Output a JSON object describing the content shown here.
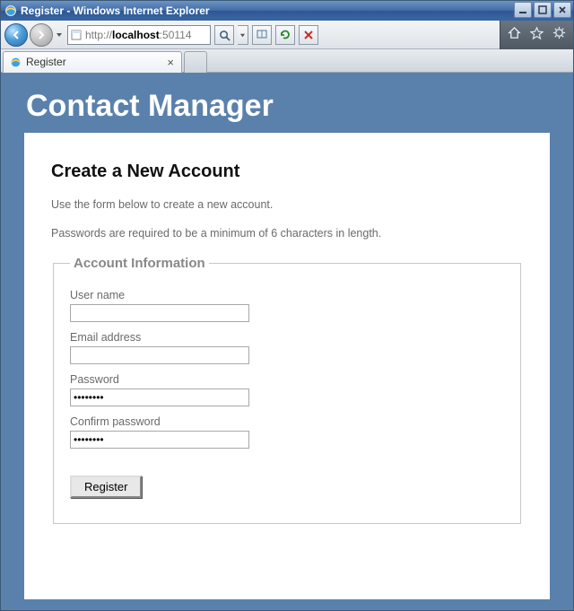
{
  "window": {
    "title": "Register - Windows Internet Explorer"
  },
  "address": {
    "scheme": "http://",
    "host": "localhost",
    "port": ":50114"
  },
  "tab": {
    "label": "Register"
  },
  "page": {
    "site_title": "Contact Manager",
    "heading": "Create a New Account",
    "intro1": "Use the form below to create a new account.",
    "intro2": "Passwords are required to be a minimum of 6 characters in length."
  },
  "form": {
    "legend": "Account Information",
    "username_label": "User name",
    "username_value": "",
    "email_label": "Email address",
    "email_value": "",
    "password_label": "Password",
    "password_value": "••••••••",
    "confirm_label": "Confirm password",
    "confirm_value": "••••••••",
    "submit_label": "Register"
  }
}
